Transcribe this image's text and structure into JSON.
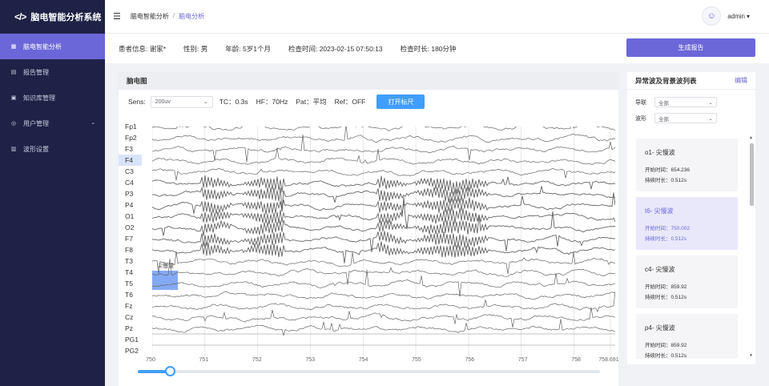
{
  "app": {
    "title": "脑电智能分析系统",
    "logo_mark": "</>"
  },
  "sidebar": {
    "items": [
      {
        "label": "脑电智能分析",
        "icon": "grid-icon",
        "active": true
      },
      {
        "label": "报告管理",
        "icon": "report-icon"
      },
      {
        "label": "知识库管理",
        "icon": "book-icon"
      },
      {
        "label": "用户管理",
        "icon": "user-icon",
        "expandable": true
      },
      {
        "label": "波形设置",
        "icon": "wave-settings-icon"
      }
    ]
  },
  "header": {
    "breadcrumb": [
      "脑电智能分析",
      "脑电分析"
    ],
    "separator": "/",
    "user": "admin",
    "user_caret": "▾"
  },
  "patient": {
    "name": "患者信息: 谢家*",
    "gender": "性别: 男",
    "age": "年龄: 5岁1个月",
    "exam_time": "检查时间: 2023-02-15 07:50:13",
    "duration": "检查时长: 180分钟",
    "generate_button": "生成报告"
  },
  "eeg": {
    "panel_title": "脑电图",
    "sens_label": "Sens:",
    "sens_value": "200uv",
    "tc": "TC：0.3s",
    "hf": "HF：70Hz",
    "pat": "Pat：平均",
    "ref": "Ref：OFF",
    "ruler_button": "打开标尺",
    "selected_channel": "F4",
    "marker_label": "尖慢波",
    "channels": [
      "Fp1",
      "Fp2",
      "F3",
      "F4",
      "C3",
      "C4",
      "P3",
      "P4",
      "O1",
      "O2",
      "F7",
      "F8",
      "T3",
      "T4",
      "T5",
      "T6",
      "Fz",
      "Cz",
      "Pz",
      "PG1",
      "PG2"
    ],
    "x_ticks": [
      "750",
      "751",
      "752",
      "753",
      "754",
      "755",
      "756",
      "757",
      "758",
      "758.691"
    ],
    "x_range": [
      750,
      758.691
    ],
    "slider_value": 0.07,
    "trace_color": "#666666",
    "marker_color": "#5b8def"
  },
  "abnormal": {
    "title": "异常波及背景波列表",
    "edit": "编辑",
    "lead_label": "导联",
    "lead_value": "全部",
    "wave_label": "波形",
    "wave_value": "全部",
    "cards": [
      {
        "title": "o1- 尖慢波",
        "start": "开始时间：654.236",
        "duration": "持续时长：0.512s",
        "selected": false
      },
      {
        "title": "t6- 尖慢波",
        "start": "开始时间：750.002",
        "duration": "持续时长：0.512s",
        "selected": true
      },
      {
        "title": "c4- 尖慢波",
        "start": "开始时间：859.92",
        "duration": "持续时长：0.512s",
        "selected": false
      },
      {
        "title": "p4- 尖慢波",
        "start": "开始时间：859.92",
        "duration": "持续时长：0.512s",
        "selected": false
      }
    ]
  },
  "colors": {
    "accent": "#6b67d9",
    "sidebar": "#1f2246",
    "blue": "#409eff"
  }
}
